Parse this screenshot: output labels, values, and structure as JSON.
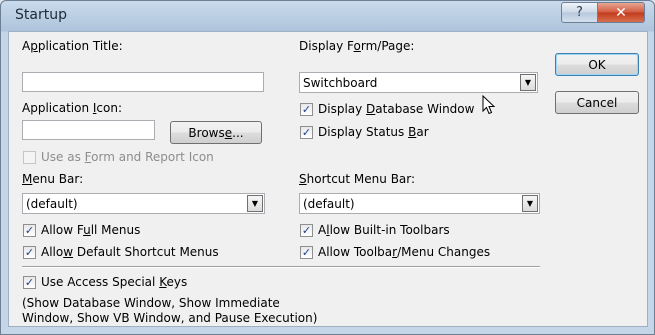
{
  "window": {
    "title": "Startup",
    "help_label": "?",
    "close_label": "✕"
  },
  "left": {
    "app_title_label_pre": "A",
    "app_title_label_ul": "p",
    "app_title_label_post": "plication Title:",
    "app_title_value": "",
    "app_icon_label_pre": "Application ",
    "app_icon_label_ul": "I",
    "app_icon_label_post": "con:",
    "app_icon_value": "",
    "browse_pre": "Brows",
    "browse_ul": "e",
    "browse_post": "...",
    "use_as_form_pre": "Use as ",
    "use_as_form_ul": "F",
    "use_as_form_post": "orm and Report Icon",
    "use_as_form_checked": false,
    "menu_bar_label_ul": "M",
    "menu_bar_label_post": "enu Bar:",
    "menu_bar_value": "(default)",
    "allow_full_menus_pre": "Allow F",
    "allow_full_menus_ul": "u",
    "allow_full_menus_post": "ll Menus",
    "allow_default_shortcut_pre": "Allo",
    "allow_default_shortcut_ul": "w",
    "allow_default_shortcut_post": " Default Shortcut Menus"
  },
  "right": {
    "display_form_pre": "Display F",
    "display_form_ul": "o",
    "display_form_post": "rm/Page:",
    "display_form_value": "Switchboard",
    "display_db_window_pre": "Display ",
    "display_db_window_ul": "D",
    "display_db_window_post": "atabase Window",
    "display_status_bar_pre": "Display Status ",
    "display_status_bar_ul": "B",
    "display_status_bar_post": "ar",
    "shortcut_menu_bar_ul": "S",
    "shortcut_menu_bar_post": "hortcut Menu Bar:",
    "shortcut_menu_bar_value": "(default)",
    "allow_builtin_pre": "A",
    "allow_builtin_ul": "l",
    "allow_builtin_post": "low Built-in Toolbars",
    "allow_toolbar_changes_pre": "Allow Toolba",
    "allow_toolbar_changes_ul": "r",
    "allow_toolbar_changes_post": "/Menu Changes"
  },
  "bottom": {
    "use_access_keys_pre": "Use Access Special ",
    "use_access_keys_ul": "K",
    "use_access_keys_post": "eys",
    "note_line1": "(Show Database Window, Show Immediate",
    "note_line2": "Window, Show VB Window, and Pause Execution)"
  },
  "buttons": {
    "ok": "OK",
    "cancel": "Cancel"
  },
  "icons": {
    "check": "✓",
    "dropdown": "▼"
  }
}
